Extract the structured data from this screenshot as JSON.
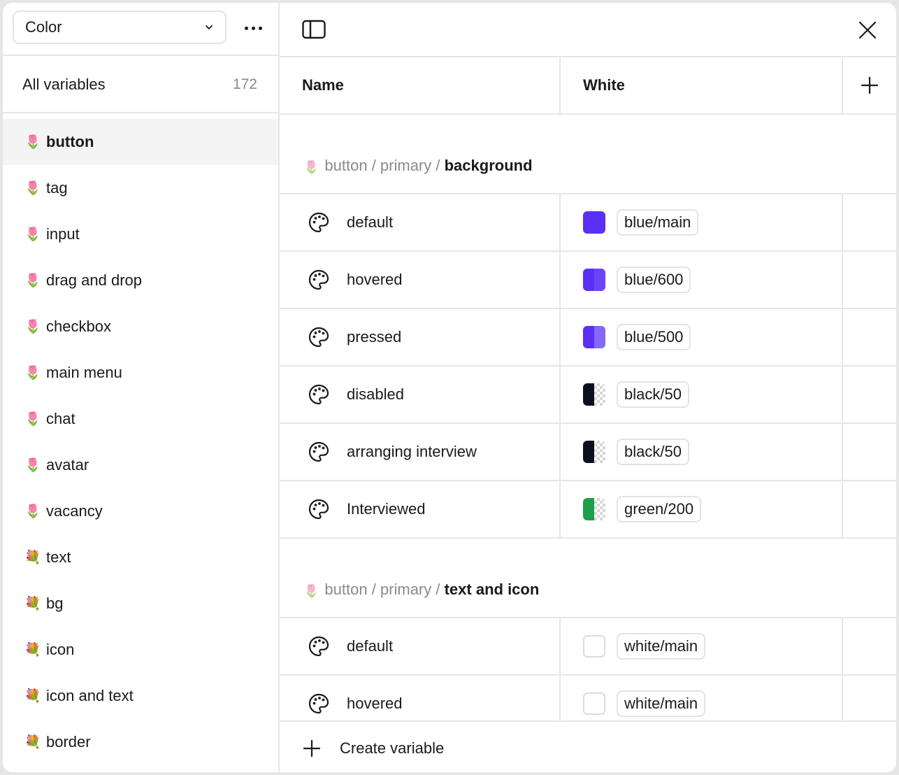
{
  "collection": {
    "selected": "Color"
  },
  "all_variables": {
    "label": "All variables",
    "count": "172"
  },
  "groups": [
    {
      "emoji": "🌷",
      "label": "button",
      "active": true
    },
    {
      "emoji": "🌷",
      "label": "tag"
    },
    {
      "emoji": "🌷",
      "label": "input"
    },
    {
      "emoji": "🌷",
      "label": "drag and drop"
    },
    {
      "emoji": "🌷",
      "label": "checkbox"
    },
    {
      "emoji": "🌷",
      "label": "main menu"
    },
    {
      "emoji": "🌷",
      "label": "chat"
    },
    {
      "emoji": "🌷",
      "label": "avatar"
    },
    {
      "emoji": "🌷",
      "label": "vacancy"
    },
    {
      "emoji": "💐",
      "label": "text"
    },
    {
      "emoji": "💐",
      "label": "bg"
    },
    {
      "emoji": "💐",
      "label": "icon"
    },
    {
      "emoji": "💐",
      "label": "icon and text"
    },
    {
      "emoji": "💐",
      "label": "border"
    }
  ],
  "table": {
    "headers": {
      "name": "Name",
      "mode": "White"
    },
    "sections": [
      {
        "emoji": "🌷",
        "path": "button / primary / ",
        "leaf": "background",
        "rows": [
          {
            "name": "default",
            "alias": "blue/main",
            "swatch_left": "#5b2ff5",
            "swatch_right": "#5b2ff5",
            "right_checker": false
          },
          {
            "name": "hovered",
            "alias": "blue/600",
            "swatch_left": "#5b2ff5",
            "swatch_right": "#6d45f7",
            "right_checker": false
          },
          {
            "name": "pressed",
            "alias": "blue/500",
            "swatch_left": "#5b2ff5",
            "swatch_right": "#8568f8",
            "right_checker": false
          },
          {
            "name": "disabled",
            "alias": "black/50",
            "swatch_left": "#0d0f1c",
            "swatch_right": "",
            "right_checker": true
          },
          {
            "name": "arranging interview",
            "alias": "black/50",
            "swatch_left": "#0d0f1c",
            "swatch_right": "",
            "right_checker": true
          },
          {
            "name": "Interviewed",
            "alias": "green/200",
            "swatch_left": "#1e9e4a",
            "swatch_right": "",
            "right_checker": true
          }
        ]
      },
      {
        "emoji": "🌷",
        "path": "button / primary / ",
        "leaf": "text and icon",
        "rows": [
          {
            "name": "default",
            "alias": "white/main",
            "swatch_left": "#ffffff",
            "swatch_right": "#ffffff",
            "right_checker": false,
            "outline": true
          },
          {
            "name": "hovered",
            "alias": "white/main",
            "swatch_left": "#ffffff",
            "swatch_right": "#ffffff",
            "right_checker": false,
            "outline": true
          }
        ]
      }
    ]
  },
  "footer": {
    "create_label": "Create variable"
  }
}
